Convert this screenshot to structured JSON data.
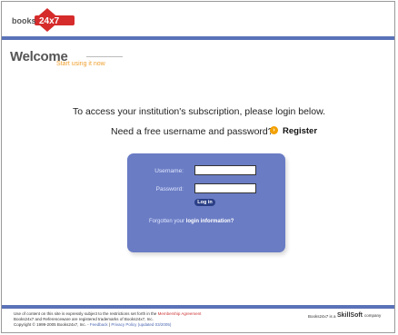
{
  "brand": {
    "logo_text_left": "books",
    "logo_text_right": "24x7",
    "accent": "#5a72b8",
    "logo_red": "#d62b2b"
  },
  "welcome": {
    "title": "Welcome",
    "tagline": "Start using it now"
  },
  "main": {
    "access_text": "To access your institution's subscription, please login below.",
    "need_text": "Need a free username and password?",
    "register_label": "Register"
  },
  "login": {
    "username_label": "Username:",
    "password_label": "Password:",
    "username_value": "",
    "password_value": "",
    "button_label": "Log in",
    "forgot_prefix": "Forgotten your",
    "forgot_link": "login information?",
    "box_color": "#6a7cc4"
  },
  "footer": {
    "line1_prefix": "Use of content on this site is expressly subject to the restrictions set forth in the",
    "line1_link": "Membership Agreement",
    "line2": "Books24x7 and Referenceware are registered trademarks of Books24x7, Inc.",
    "line3_prefix": "Copyright © 1999-2005 Books24x7, Inc. -",
    "feedback": "Feedback",
    "privacy": "Privacy Policy (updated 03/2005)",
    "right_text": "Books24x7 is a",
    "skill_brand": "SkillSoft",
    "skill_suffix": "company"
  }
}
